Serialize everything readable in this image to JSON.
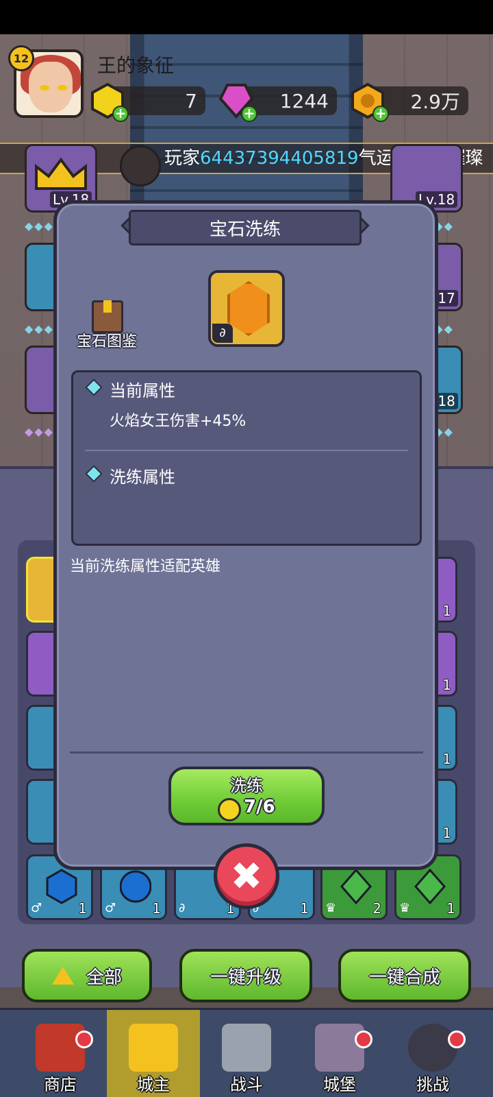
{
  "header": {
    "level": "12",
    "player_name": "王的象征",
    "resources": [
      {
        "name": "gold-gem",
        "value": "7",
        "color": "#f2d21b"
      },
      {
        "name": "pink-gem",
        "value": "1244",
        "color": "#d94fc8"
      },
      {
        "name": "coin",
        "value": "2.9万",
        "color": "#f2a91b"
      }
    ]
  },
  "ticker": {
    "prefix": "玩家",
    "player_id": "64437394405819",
    "suffix": "气运惊人，璀璨"
  },
  "side_cards": {
    "left_top_level": "Lv.18",
    "right_top_level": "Lv.18",
    "right_mid_level": ".17",
    "right_low_level": ".18"
  },
  "dialog": {
    "title": "宝石洗练",
    "book_label": "宝石图鉴",
    "current_attr_title": "当前属性",
    "current_attr_value": "火焰女王伤害+45%",
    "refine_attr_title": "洗练属性",
    "adapt_text": "当前洗练属性适配英雄",
    "refine_button": "洗练",
    "refine_cost": "7/6",
    "close_icon": "✖"
  },
  "gem_grid": {
    "row_counts": [
      "1",
      "1",
      "1",
      "1"
    ],
    "bottom_row": [
      {
        "sym": "♂",
        "count": "1",
        "color": "#2a8ad8"
      },
      {
        "sym": "♂",
        "count": "1",
        "color": "#2a8ad8"
      },
      {
        "sym": "∂",
        "count": "1",
        "color": "#2a8ad8"
      },
      {
        "sym": "∂",
        "count": "1",
        "color": "#2a8ad8"
      },
      {
        "sym": "♛",
        "count": "2",
        "color": "#3c9a3a"
      },
      {
        "sym": "♛",
        "count": "1",
        "color": "#3c9a3a"
      }
    ]
  },
  "actions": {
    "all": "全部",
    "upgrade_all": "一键升级",
    "merge_all": "一键合成"
  },
  "nav": [
    {
      "label": "商店",
      "icon": "shop-icon"
    },
    {
      "label": "城主",
      "icon": "crown-icon"
    },
    {
      "label": "战斗",
      "icon": "swords-icon"
    },
    {
      "label": "城堡",
      "icon": "castle-icon"
    },
    {
      "label": "挑战",
      "icon": "demon-icon"
    }
  ]
}
